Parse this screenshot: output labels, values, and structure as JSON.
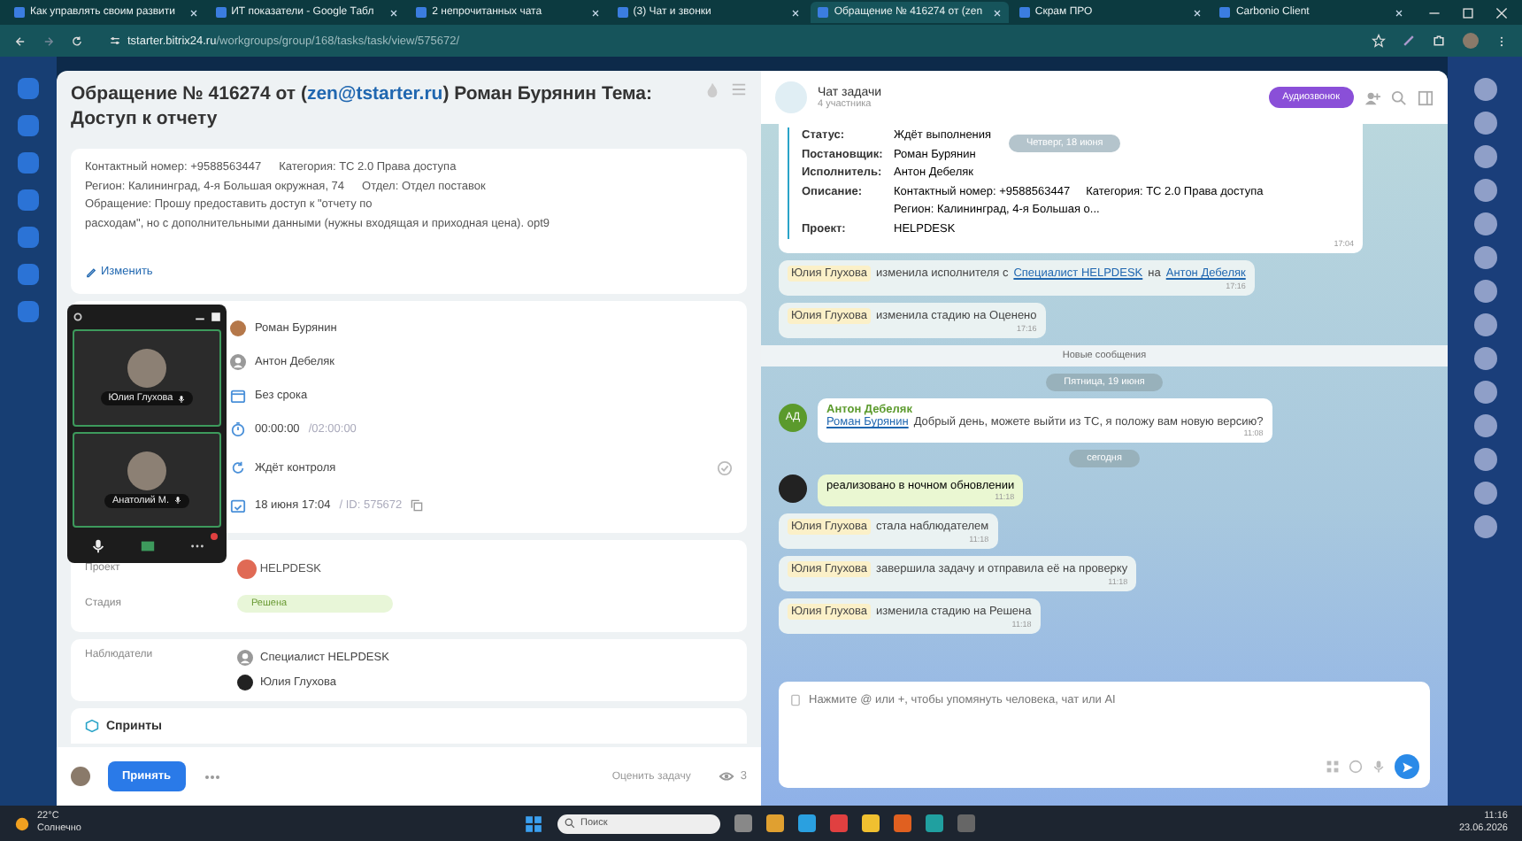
{
  "browser": {
    "tabs": [
      {
        "title": "Как управлять своим развити",
        "selected": false
      },
      {
        "title": "ИТ показатели - Google Табл",
        "selected": false
      },
      {
        "title": "2 непрочитанных чата",
        "selected": false
      },
      {
        "title": "(3) Чат и звонки",
        "selected": false
      },
      {
        "title": "Обращение № 416274 от (zen",
        "selected": true
      },
      {
        "title": "Скрам ПРО",
        "selected": false
      },
      {
        "title": "Carbonio Client",
        "selected": false
      }
    ],
    "url_host": "tstarter.bitrix24.ru",
    "url_path": "/workgroups/group/168/tasks/task/view/575672/"
  },
  "task": {
    "title_before": "Обращение № 416274 от (",
    "title_link": "zen@tstarter.ru",
    "title_after": ") Роман Бурянин Тема: Доступ к отчету",
    "description": [
      [
        "Контактный номер: +9588563447",
        "Категория: ТС 2.0 Права доступа"
      ],
      [
        "Регион: Калининград, 4-я Большая окружная, 74",
        "Отдел: Отдел поставок"
      ],
      [
        "Обращение: Прошу предоставить доступ к \"отчету по"
      ],
      [
        "расходам\", но с дополнительными данными (нужны входящая и приходная цена). opt9"
      ]
    ],
    "edit_link": "Изменить",
    "rows": [
      {
        "kind": "creator",
        "text": "Роман Бурянин"
      },
      {
        "kind": "user",
        "text": "Антон Дебеляк"
      },
      {
        "kind": "deadline",
        "text": "Без срока"
      },
      {
        "kind": "timer",
        "text": "00:00:00",
        "secondary": "/02:00:00"
      },
      {
        "kind": "status",
        "text": "Ждёт контроля"
      },
      {
        "kind": "created",
        "text": "18 июня 17:04",
        "secondary": "/ ID: 575672"
      }
    ],
    "project": {
      "label": "Проект",
      "value": "HELPDESK"
    },
    "stage": {
      "label": "Стадия",
      "value": "Решена"
    },
    "watchers": {
      "label": "Наблюдатели",
      "items": [
        {
          "name": "Специалист HELPDESK",
          "kind": "user"
        },
        {
          "name": "Юлия Глухова",
          "kind": "photo"
        }
      ]
    },
    "sprints": "Спринты",
    "accept_button": "Принять",
    "rate_link": "Оценить задачу",
    "views": "3"
  },
  "call": {
    "participants": [
      {
        "name": "Юлия Глухова"
      },
      {
        "name": "Анатолий М."
      }
    ]
  },
  "chat": {
    "title": "Чат задачи",
    "subtitle": "4 участника",
    "audio_button": "Аудиозвонок",
    "messages": [
      {
        "kind": "card",
        "date_pill": "Четверг, 18 июня",
        "fields": [
          {
            "label": "Статус:",
            "lines": [
              "Ждёт выполнения"
            ]
          },
          {
            "label": "Постановщик:",
            "lines": [
              "Роман Бурянин"
            ]
          },
          {
            "label": "Исполнитель:",
            "lines": [
              "Антон Дебеляк"
            ]
          },
          {
            "label": "Описание:",
            "lines": [
              "Контактный номер: +9588563447     Категория: ТС 2.0 Права доступа",
              "Регион: Калининград, 4-я Большая о..."
            ]
          },
          {
            "label": "Проект:",
            "lines": [
              "HELPDESK"
            ]
          }
        ],
        "time": "17:04"
      },
      {
        "kind": "system",
        "author": "Юлия Глухова",
        "parts": [
          {
            "text": "изменила исполнителя с"
          },
          {
            "link": "Специалист HELPDESK"
          },
          {
            "text": "на"
          },
          {
            "link": "Антон Дебеляк"
          }
        ],
        "time": "17:16"
      },
      {
        "kind": "system",
        "author": "Юлия Глухова",
        "parts": [
          {
            "text": "изменила стадию на Оценено"
          }
        ],
        "time": "17:16"
      },
      {
        "kind": "divider",
        "text": "Новые сообщения"
      },
      {
        "kind": "date",
        "text": "Пятница, 19 июня"
      },
      {
        "kind": "incoming",
        "initials": "АД",
        "author": "Антон Дебеляк",
        "mention": "Роман Бурянин",
        "text": "Добрый день, можете выйти из ТС, я положу вам новую версию?",
        "time": "11:08"
      },
      {
        "kind": "date",
        "text": "сегодня"
      },
      {
        "kind": "own",
        "text": "реализовано в ночном обновлении",
        "time": "11:18"
      },
      {
        "kind": "system",
        "author": "Юлия Глухова",
        "parts": [
          {
            "text": "стала наблюдателем"
          }
        ],
        "time": "11:18"
      },
      {
        "kind": "system",
        "author": "Юлия Глухова",
        "parts": [
          {
            "text": "завершила задачу и отправила её на проверку"
          }
        ],
        "time": "11:18"
      },
      {
        "kind": "system",
        "author": "Юлия Глухова",
        "parts": [
          {
            "text": "изменила стадию на Решена"
          }
        ],
        "time": "11:18"
      }
    ],
    "input_placeholder": "Нажмите @ или +, чтобы упомянуть человека, чат или AI"
  },
  "taskbar": {
    "temperature": "22°C",
    "weather": "Солнечно",
    "search_placeholder": "Поиск",
    "time": "11:16",
    "date": "23.06.2026"
  }
}
